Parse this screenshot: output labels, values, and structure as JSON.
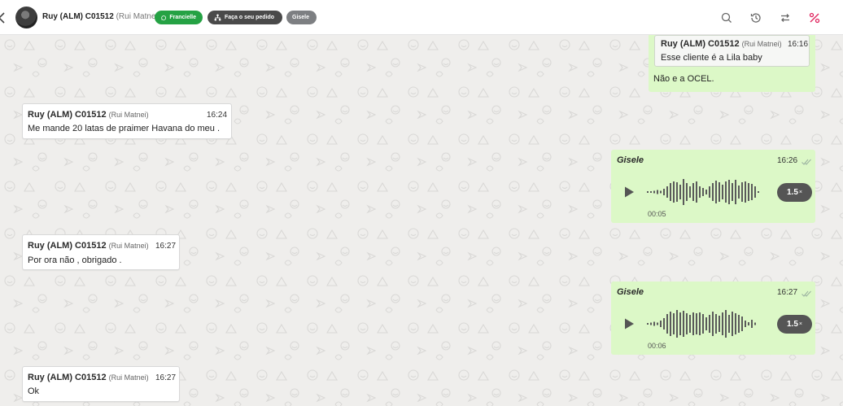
{
  "header": {
    "contact_name": "Ruy (ALM) C01512",
    "contact_sub": "(Rui Matnei)",
    "chips": {
      "agent": "Francielle",
      "order": "Faça o seu pedido",
      "user": "Gisele"
    },
    "colors": {
      "agent_chip": "#25a244",
      "order_chip": "#4a4a4a",
      "user_chip": "#7d7f82",
      "accent_red": "#e0245e"
    }
  },
  "messages": {
    "m0": {
      "quote_sender": "Ruy (ALM) C01512",
      "quote_sub": "(Rui Matnei)",
      "quote_time": "16:16",
      "quote_text": "Esse cliente é a Lila baby",
      "text": "Não e a OCEL."
    },
    "m1": {
      "sender": "Ruy (ALM) C01512",
      "sub": "(Rui Matnei)",
      "time": "16:24",
      "text": "Me mande 20 latas de praimer Havana do meu ."
    },
    "m2": {
      "sender": "Gisele",
      "time": "16:26",
      "speed": "1.5",
      "speed_x": "×",
      "duration": "00:05"
    },
    "m3": {
      "sender": "Ruy (ALM) C01512",
      "sub": "(Rui Matnei)",
      "time": "16:27",
      "text": "Por ora não , obrigado ."
    },
    "m4": {
      "sender": "Gisele",
      "time": "16:27",
      "speed": "1.5",
      "speed_x": "×",
      "duration": "00:06"
    },
    "m5": {
      "sender": "Ruy (ALM) C01512",
      "sub": "(Rui Matnei)",
      "time": "16:27",
      "text": "Ok"
    }
  },
  "audio": {
    "wave1": [
      2,
      2,
      3,
      5,
      3,
      8,
      14,
      22,
      26,
      24,
      18,
      32,
      22,
      14,
      22,
      26,
      14,
      10,
      6,
      14,
      22,
      28,
      24,
      18,
      26,
      30,
      22,
      30,
      16,
      24,
      26,
      22,
      20,
      14,
      2
    ],
    "wave2": [
      2,
      3,
      5,
      3,
      8,
      14,
      24,
      30,
      26,
      34,
      28,
      32,
      26,
      22,
      28,
      26,
      28,
      24,
      16,
      22,
      30,
      24,
      20,
      28,
      34,
      22,
      30,
      26,
      22,
      18,
      8,
      4,
      10,
      3
    ]
  },
  "icons": [
    "back-chevron-icon",
    "whatsapp-icon",
    "sitemap-icon",
    "search-icon",
    "history-icon",
    "transfer-icon",
    "percent-icon",
    "play-icon",
    "double-check-icon"
  ]
}
